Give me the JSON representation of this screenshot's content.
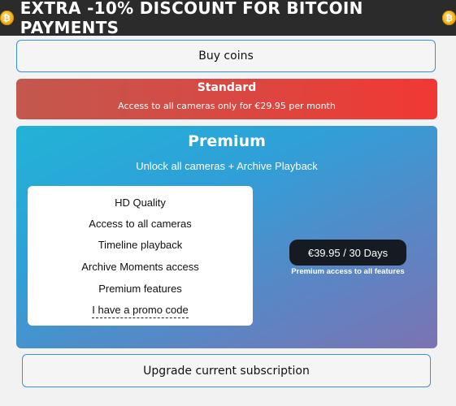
{
  "banner": {
    "text": "EXTRA -10% DISCOUNT FOR BITCOIN PAYMENTS",
    "icon": "bitcoin-coin-icon",
    "coin_glyph": "₿",
    "accent": "#f2a900"
  },
  "buy_coins": {
    "label": "Buy coins"
  },
  "standard": {
    "title": "Standard",
    "subtitle": "Access to all cameras only for €29.95 per month",
    "color": "#f23833"
  },
  "premium": {
    "title": "Premium",
    "subtitle": "Unlock all cameras + Archive Playback",
    "features": [
      "HD Quality",
      "Access to all cameras",
      "Timeline playback",
      "Archive Moments access",
      "Premium features"
    ],
    "promo_link": "I have a promo code",
    "price": "€39.95 / 30 Days",
    "price_note": "Premium access to all features"
  },
  "upgrade": {
    "label": "Upgrade current subscription"
  }
}
